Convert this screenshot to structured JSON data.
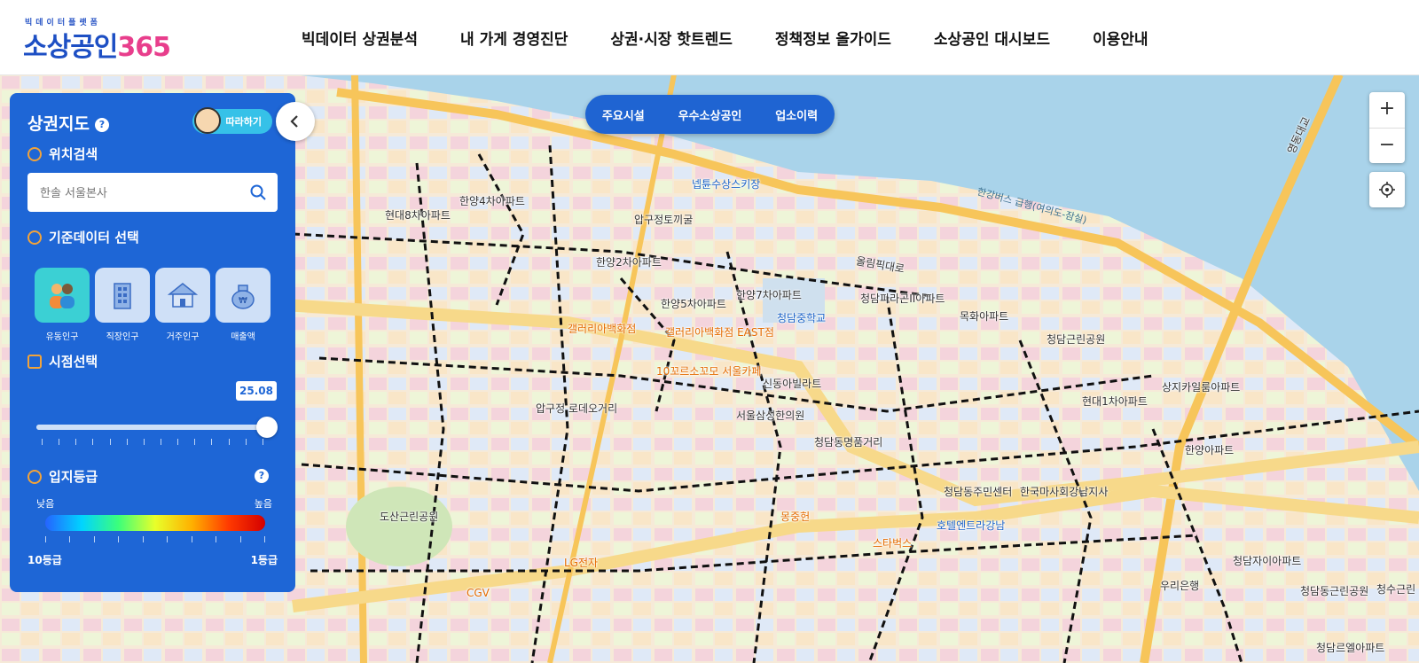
{
  "header": {
    "logo_top": "빅데이터플랫폼",
    "logo_text": "소상공인",
    "logo_num": "365",
    "nav": [
      "빅데이터 상권분석",
      "내 가게 경영진단",
      "상권·시장 핫트렌드",
      "정책정보 올가이드",
      "소상공인 대시보드",
      "이용안내"
    ]
  },
  "map": {
    "pill_tabs": [
      "주요시설",
      "우수소상공인",
      "업소이력"
    ],
    "zoom_in": "+",
    "zoom_out": "−",
    "labels": {
      "l1": "한양4차아파트",
      "l2": "현대8차아파트",
      "l3": "압구정토끼굴",
      "l4": "넵튠수상스키장",
      "l5": "한강버스 급행(여의도-잠실)",
      "l6": "올림픽대로",
      "l7": "한양2차아파트",
      "l8": "한양5차아파트",
      "l9": "한양7차아파트",
      "l10": "청담중학교",
      "l11": "청담파라곤II아파트",
      "l12": "목화아파트",
      "l13": "갤러리아백화점",
      "l14": "갤러리아백화점 EAST점",
      "l15": "신동아빌라트",
      "l16": "서울삼성한의원",
      "l17": "청담동명품거리",
      "l18": "도산근린공원",
      "l19": "청담동주민센터",
      "l20": "한국마사회강남지사",
      "l21": "청담근린공원",
      "l22": "상지카일룸아파트",
      "l23": "호텔엔트라강남",
      "l24": "몽중헌",
      "l25": "스타벅스",
      "l26": "LG전자",
      "l27": "CGV",
      "l28": "청담자이아파트",
      "l29": "청담동근린공원",
      "l30": "영동대교",
      "l31": "청수근린",
      "l32": "한양아파트",
      "l33": "청담르엘아파트",
      "l34": "우리은행",
      "l35": "현대1차아파트",
      "l36": "10꼬르소꼬모 서울카페",
      "l37": "압구정 로데오거리"
    }
  },
  "panel": {
    "title": "상권지도",
    "help": "?",
    "follow_label": "따라하기",
    "search_section": "위치검색",
    "search_placeholder": "한솔 서울본사",
    "data_section": "기준데이터 선택",
    "tiles": [
      "유동인구",
      "직장인구",
      "거주인구",
      "매출액"
    ],
    "active_tile": "유동인구",
    "time_section": "시점선택",
    "time_value": "25.08",
    "time_position": 1.0,
    "grade_section": "입지등급",
    "grade_low": "낮음",
    "grade_high": "높음",
    "grade_min": "10등급",
    "grade_max": "1등급",
    "collapse_icon": "chevron-left-icon"
  },
  "colors": {
    "primary": "#1e66d6",
    "river": "#a9d3ea",
    "road": "#f7c55a"
  }
}
